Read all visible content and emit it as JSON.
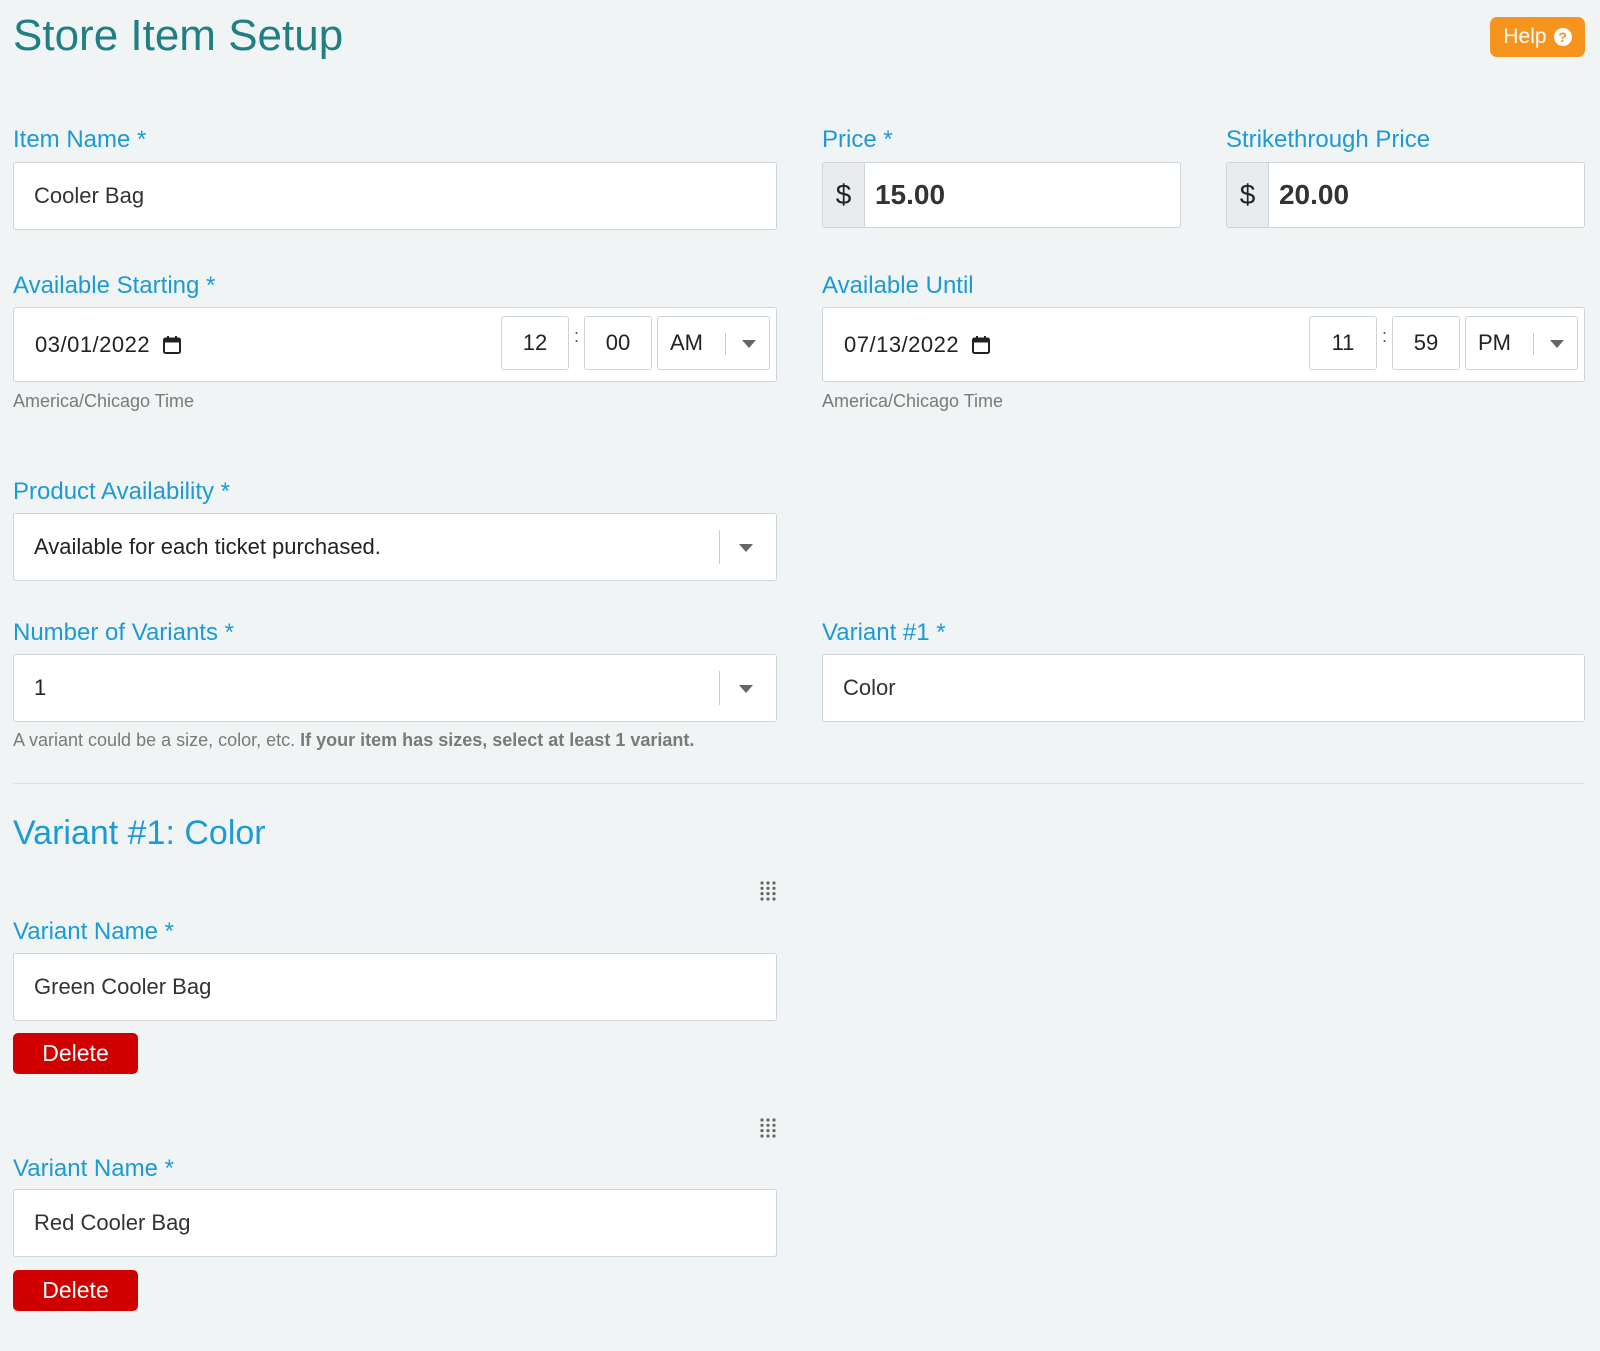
{
  "header": {
    "title": "Store Item Setup",
    "help_label": "Help"
  },
  "item_name": {
    "label": "Item Name *",
    "value": "Cooler Bag"
  },
  "price": {
    "label": "Price *",
    "currency": "$",
    "value": "15.00"
  },
  "strikethrough_price": {
    "label": "Strikethrough Price",
    "currency": "$",
    "value": "20.00"
  },
  "available_starting": {
    "label": "Available Starting *",
    "date": "03/01/2022",
    "hour": "12",
    "minute": "00",
    "ampm": "AM",
    "timezone": "America/Chicago Time"
  },
  "available_until": {
    "label": "Available Until",
    "date": "07/13/2022",
    "hour": "11",
    "minute": "59",
    "ampm": "PM",
    "timezone": "America/Chicago Time"
  },
  "product_availability": {
    "label": "Product Availability *",
    "value": "Available for each ticket purchased."
  },
  "number_of_variants": {
    "label": "Number of Variants *",
    "value": "1",
    "help_text": "A variant could be a size, color, etc.",
    "help_bold": "If your item has sizes, select at least 1 variant."
  },
  "variant_1": {
    "label": "Variant #1 *",
    "value": "Color"
  },
  "variant_section": {
    "title": "Variant #1: Color",
    "options": [
      {
        "label": "Variant Name *",
        "value": "Green Cooler Bag",
        "delete_label": "Delete"
      },
      {
        "label": "Variant Name *",
        "value": "Red Cooler Bag",
        "delete_label": "Delete"
      }
    ]
  },
  "colors": {
    "title": "#1f7f85",
    "label": "#1c9ad6",
    "help": "#f7941d",
    "delete": "#d10000"
  },
  "icons": {
    "help": "question-circle-icon",
    "calendar": "calendar-icon",
    "dropdown": "caret-down-icon",
    "drag": "drag-handle-icon"
  }
}
